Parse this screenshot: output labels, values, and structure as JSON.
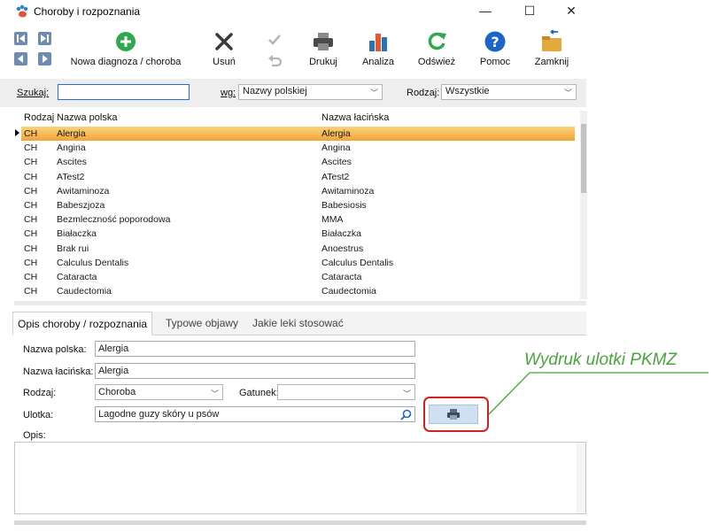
{
  "window": {
    "title": "Choroby i rozpoznania",
    "controls": {
      "minimize": "—",
      "maximize": "☐",
      "close": "✕"
    }
  },
  "toolbar": {
    "new_label": "Nowa diagnoza / choroba",
    "delete_label": "Usuń",
    "print_label": "Drukuj",
    "analysis_label": "Analiza",
    "refresh_label": "Odśwież",
    "help_label": "Pomoc",
    "close_label": "Zamknij"
  },
  "search": {
    "search_label": "Szukaj:",
    "search_value": "",
    "by_label": "wg:",
    "by_value": "Nazwy polskiej",
    "type_label": "Rodzaj:",
    "type_value": "Wszystkie"
  },
  "grid": {
    "columns": [
      "Rodzaj",
      "Nazwa polska",
      "Nazwa łacińska"
    ],
    "rows": [
      [
        "CH",
        "Alergia",
        "Alergia"
      ],
      [
        "CH",
        "Angina",
        "Angina"
      ],
      [
        "CH",
        "Ascites",
        "Ascites"
      ],
      [
        "CH",
        "ATest2",
        "ATest2"
      ],
      [
        "CH",
        "Awitaminoza",
        "Awitaminoza"
      ],
      [
        "CH",
        "Babeszjoza",
        "Babesiosis"
      ],
      [
        "CH",
        "Bezmleczność poporodowa",
        "MMA"
      ],
      [
        "CH",
        "Białaczka",
        "Białaczka"
      ],
      [
        "CH",
        "Brak rui",
        "Anoestrus"
      ],
      [
        "CH",
        "Calculus Dentalis",
        "Calculus Dentalis"
      ],
      [
        "CH",
        "Cataracta",
        "Cataracta"
      ],
      [
        "CH",
        "Caudectomia",
        "Caudectomia"
      ]
    ],
    "selected_row": 0
  },
  "tabs": [
    "Opis choroby / rozpoznania",
    "Typowe objawy",
    "Jakie leki stosować"
  ],
  "form": {
    "polish_name_label": "Nazwa polska:",
    "polish_name_value": "Alergia",
    "latin_name_label": "Nazwa łacińska:",
    "latin_name_value": "Alergia",
    "type_label": "Rodzaj:",
    "type_value": "Choroba",
    "species_label": "Gatunek:",
    "species_value": "",
    "leaflet_label": "Ulotka:",
    "leaflet_value": "Lagodne guzy skóry u psów",
    "description_label": "Opis:"
  },
  "annotation": {
    "callout_text": "Wydruk ulotki PKMZ",
    "callout_color": "#4aa33e",
    "highlight_color": "#d11f1f"
  },
  "icons": [
    "paw-logo-icon",
    "first-record-icon",
    "last-record-icon",
    "prev-record-icon",
    "next-record-icon",
    "add-icon",
    "delete-icon",
    "confirm-icon",
    "undo-icon",
    "printer-icon",
    "bar-chart-icon",
    "refresh-icon",
    "help-icon",
    "exit-folder-icon",
    "magnifier-icon"
  ]
}
